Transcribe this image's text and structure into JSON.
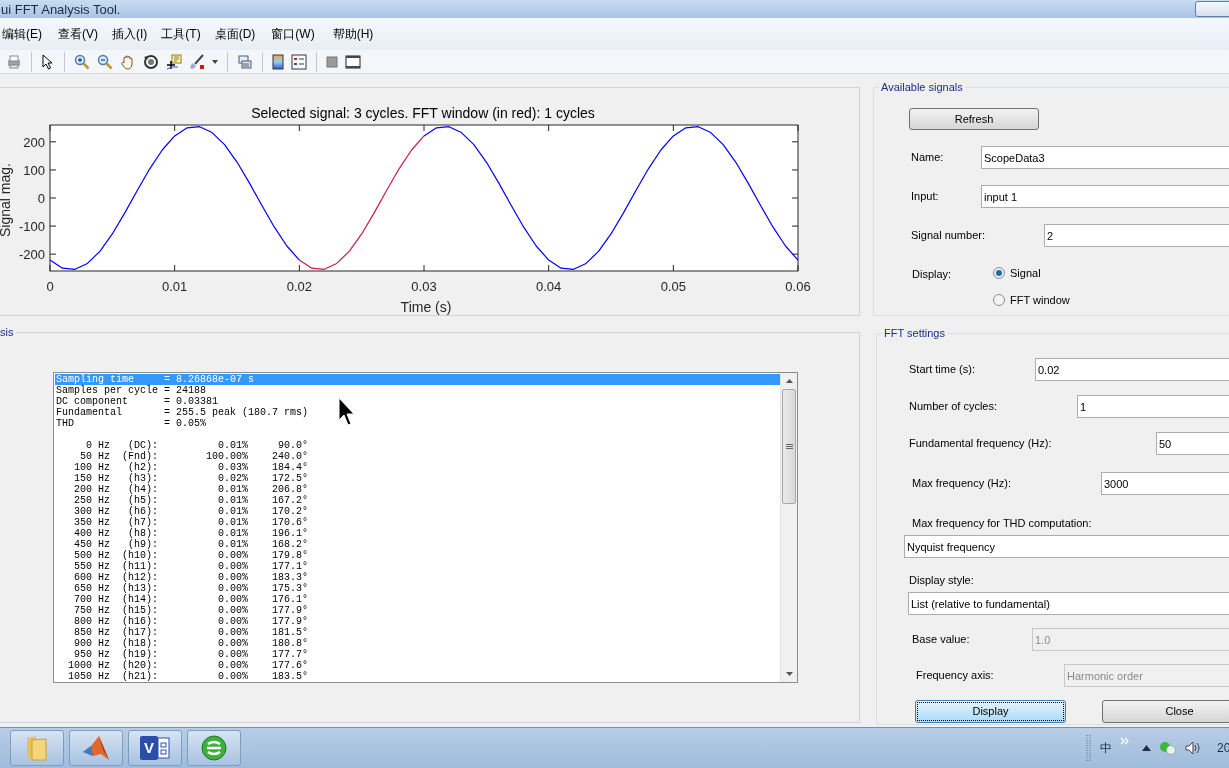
{
  "window": {
    "title": "ui FFT Analysis Tool."
  },
  "menu": [
    "编辑(E)",
    "查看(V)",
    "插入(I)",
    "工具(T)",
    "桌面(D)",
    "窗口(W)",
    "帮助(H)"
  ],
  "plot": {
    "chart_data": {
      "type": "line",
      "title": "Selected signal: 3 cycles. FFT window (in red): 1 cycles",
      "xlabel": "Time (s)",
      "ylabel": "Signal mag.",
      "xlim": [
        0,
        0.06
      ],
      "ylim": [
        -260,
        260
      ],
      "xticks": [
        0,
        0.01,
        0.02,
        0.03,
        0.04,
        0.05,
        0.06
      ],
      "yticks": [
        -200,
        -100,
        0,
        100,
        200
      ],
      "x": [
        0,
        0.001,
        0.002,
        0.003,
        0.004,
        0.005,
        0.006,
        0.007,
        0.008,
        0.009,
        0.01,
        0.011,
        0.012,
        0.013,
        0.014,
        0.015,
        0.016,
        0.017,
        0.018,
        0.019,
        0.02,
        0.021,
        0.022,
        0.023,
        0.024,
        0.025,
        0.026,
        0.027,
        0.028,
        0.029,
        0.03,
        0.031,
        0.032,
        0.033,
        0.034,
        0.035,
        0.036,
        0.037,
        0.038,
        0.039,
        0.04,
        0.041,
        0.042,
        0.043,
        0.044,
        0.045,
        0.046,
        0.047,
        0.048,
        0.049,
        0.05,
        0.051,
        0.052,
        0.053,
        0.054,
        0.055,
        0.056,
        0.057,
        0.058,
        0.059,
        0.06
      ],
      "series": [
        {
          "color": "#0000ff",
          "values": [
            -221,
            -250,
            -254,
            -233,
            -190,
            -128,
            -53,
            27,
            104,
            171,
            221,
            250,
            254,
            233,
            190,
            128,
            53,
            -27,
            -104,
            -171,
            -221,
            null,
            null,
            null,
            null,
            null,
            null,
            null,
            null,
            null,
            221,
            250,
            254,
            233,
            190,
            128,
            53,
            -27,
            -104,
            -171,
            -221,
            -250,
            -254,
            -233,
            -190,
            -128,
            -53,
            27,
            104,
            171,
            221,
            250,
            254,
            233,
            190,
            128,
            53,
            -27,
            -104,
            -171,
            -221
          ]
        },
        {
          "color": "#cc1a4a",
          "values": [
            null,
            null,
            null,
            null,
            null,
            null,
            null,
            null,
            null,
            null,
            null,
            null,
            null,
            null,
            null,
            null,
            null,
            null,
            null,
            null,
            -221,
            -250,
            -254,
            -233,
            -190,
            -128,
            -53,
            27,
            104,
            171,
            221,
            null,
            null,
            null,
            null,
            null,
            null,
            null,
            null,
            null,
            null,
            null,
            null,
            null,
            null,
            null,
            null,
            null,
            null,
            null,
            null,
            null,
            null,
            null,
            null,
            null,
            null,
            null,
            null,
            null,
            null
          ]
        }
      ]
    }
  },
  "analysis": {
    "legend": "sis",
    "listbox": {
      "summary": [
        {
          "text": "Sampling time     = 8.26868e-07 s",
          "selected": true
        },
        {
          "text": "Samples per cycle = 24188",
          "selected": false
        },
        {
          "text": "DC component      = 0.03381",
          "selected": false
        },
        {
          "text": "Fundamental       = 255.5 peak (180.7 rms)",
          "selected": false
        },
        {
          "text": "THD               = 0.05%",
          "selected": false
        }
      ],
      "harmonics": [
        {
          "text": "     0 Hz   (DC):          0.01%     90.0°",
          "selected": false
        },
        {
          "text": "    50 Hz  (Fnd):        100.00%    240.0°",
          "selected": false
        },
        {
          "text": "   100 Hz   (h2):          0.03%    184.4°",
          "selected": false
        },
        {
          "text": "   150 Hz   (h3):          0.02%    172.5°",
          "selected": false
        },
        {
          "text": "   200 Hz   (h4):          0.01%    206.8°",
          "selected": false
        },
        {
          "text": "   250 Hz   (h5):          0.01%    167.2°",
          "selected": false
        },
        {
          "text": "   300 Hz   (h6):          0.01%    170.2°",
          "selected": false
        },
        {
          "text": "   350 Hz   (h7):          0.01%    170.6°",
          "selected": false
        },
        {
          "text": "   400 Hz   (h8):          0.01%    196.1°",
          "selected": false
        },
        {
          "text": "   450 Hz   (h9):          0.01%    168.2°",
          "selected": false
        },
        {
          "text": "   500 Hz  (h10):          0.00%    179.8°",
          "selected": false
        },
        {
          "text": "   550 Hz  (h11):          0.00%    177.1°",
          "selected": false
        },
        {
          "text": "   600 Hz  (h12):          0.00%    183.3°",
          "selected": false
        },
        {
          "text": "   650 Hz  (h13):          0.00%    175.3°",
          "selected": false
        },
        {
          "text": "   700 Hz  (h14):          0.00%    176.1°",
          "selected": false
        },
        {
          "text": "   750 Hz  (h15):          0.00%    177.9°",
          "selected": false
        },
        {
          "text": "   800 Hz  (h16):          0.00%    177.9°",
          "selected": false
        },
        {
          "text": "   850 Hz  (h17):          0.00%    181.5°",
          "selected": false
        },
        {
          "text": "   900 Hz  (h18):          0.00%    180.8°",
          "selected": false
        },
        {
          "text": "   950 Hz  (h19):          0.00%    177.7°",
          "selected": false
        },
        {
          "text": "  1000 Hz  (h20):          0.00%    177.6°",
          "selected": false
        },
        {
          "text": "  1050 Hz  (h21):          0.00%    183.5°",
          "selected": false
        }
      ]
    }
  },
  "available_signals": {
    "legend": "Available signals",
    "refresh_button": "Refresh",
    "fields": [
      {
        "label": "Name:",
        "value": "ScopeData3"
      },
      {
        "label": "Input:",
        "value": "input 1"
      },
      {
        "label": "Signal number:",
        "value": "2"
      }
    ],
    "display": {
      "label": "Display:",
      "options": [
        {
          "label": "Signal",
          "selected": true
        },
        {
          "label": "FFT window",
          "selected": false
        }
      ]
    }
  },
  "fft_settings": {
    "legend": "FFT settings",
    "fields": [
      {
        "kind": "text",
        "label": "Start time (s):",
        "value": "0.02",
        "disabled": false
      },
      {
        "kind": "text",
        "label": "Number of cycles:",
        "value": "1",
        "disabled": false
      },
      {
        "kind": "text",
        "label": "Fundamental frequency (Hz):",
        "value": "50",
        "disabled": false
      },
      {
        "kind": "text",
        "label": "Max frequency (Hz):",
        "value": "3000",
        "disabled": false
      },
      {
        "kind": "popup",
        "label": "Max frequency for THD computation:",
        "value": "Nyquist frequency",
        "disabled": false
      },
      {
        "kind": "popup",
        "label": "Display style:",
        "value": "List (relative to fundamental)",
        "disabled": false
      },
      {
        "kind": "text",
        "label": "Base value:",
        "value": "1.0",
        "disabled": true
      },
      {
        "kind": "inline_popup",
        "label": "Frequency axis:",
        "value": "Harmonic order",
        "disabled": true
      }
    ],
    "buttons": [
      {
        "label": "Display",
        "focused": true
      },
      {
        "label": "Close",
        "focused": false
      }
    ]
  },
  "taskbar": {
    "apps": [
      {
        "kind": "folder"
      },
      {
        "kind": "peak"
      },
      {
        "kind": "document",
        "letter": "V"
      },
      {
        "kind": "globe"
      }
    ],
    "tray": {
      "ime": "中",
      "clock": "20"
    }
  }
}
